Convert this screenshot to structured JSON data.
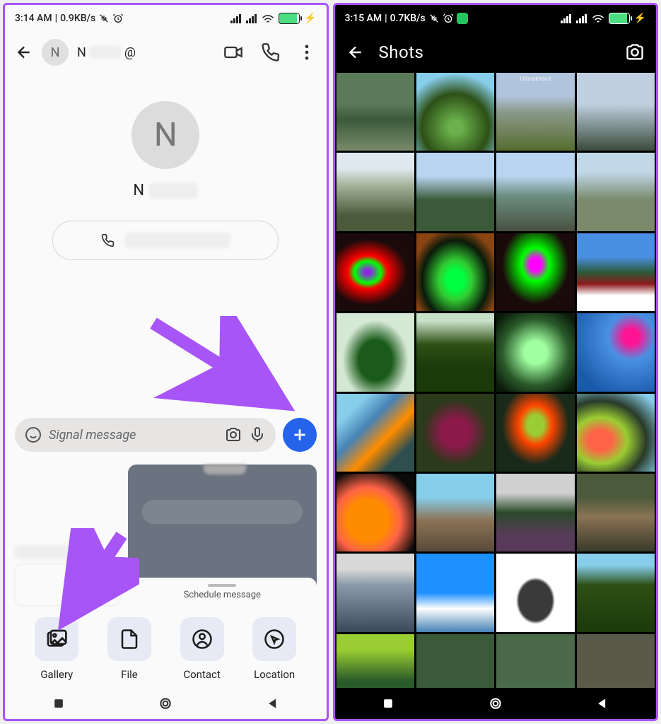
{
  "left": {
    "status": {
      "time": "3:14 AM",
      "net": "0.9KB/s",
      "battery_pct": 91
    },
    "header": {
      "avatar_initial": "N",
      "name_prefix": "N",
      "at_symbol": "@"
    },
    "profile": {
      "avatar_initial": "N",
      "name_prefix": "N"
    },
    "input": {
      "placeholder": "Signal message"
    },
    "schedule_label": "Schedule message",
    "attachments": {
      "gallery": "Gallery",
      "file": "File",
      "contact": "Contact",
      "location": "Location"
    }
  },
  "right": {
    "status": {
      "time": "3:15 AM",
      "net": "0.7KB/s",
      "battery_pct": 91
    },
    "header": {
      "title": "Shots"
    },
    "thumb_watermark": "Uttarakhand"
  },
  "colors": {
    "accent_purple": "#a855f7",
    "plus_blue": "#2563eb"
  }
}
